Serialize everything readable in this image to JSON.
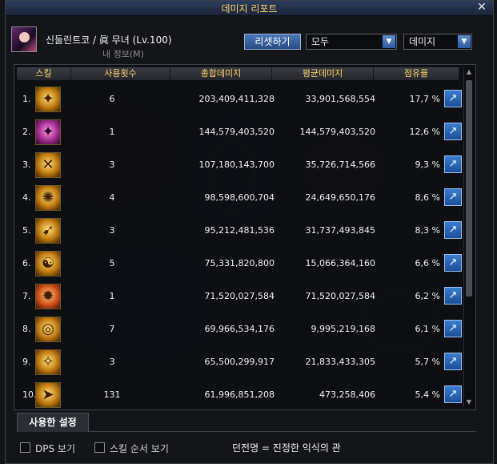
{
  "window": {
    "title": "데미지 리포트",
    "close_label": "✕"
  },
  "character": {
    "name": "신들린트코 / 眞 무녀 (Lv.100)",
    "subtitle": "내 정보(M)"
  },
  "controls": {
    "reset_label": "리셋하기",
    "filter_select": "모두",
    "metric_select": "데미지"
  },
  "table": {
    "headers": [
      "스킬",
      "사용횟수",
      "총합데미지",
      "평균데미지",
      "점유율"
    ],
    "rows": [
      {
        "index": "1.",
        "count": "6",
        "total": "203,409,411,328",
        "avg": "33,901,568,554",
        "share": "17,7 %"
      },
      {
        "index": "2.",
        "count": "1",
        "total": "144,579,403,520",
        "avg": "144,579,403,520",
        "share": "12,6 %"
      },
      {
        "index": "3.",
        "count": "3",
        "total": "107,180,143,700",
        "avg": "35,726,714,566",
        "share": "9,3 %"
      },
      {
        "index": "4.",
        "count": "4",
        "total": "98,598,600,704",
        "avg": "24,649,650,176",
        "share": "8,6 %"
      },
      {
        "index": "5.",
        "count": "3",
        "total": "95,212,481,536",
        "avg": "31,737,493,845",
        "share": "8,3 %"
      },
      {
        "index": "6.",
        "count": "5",
        "total": "75,331,820,800",
        "avg": "15,066,364,160",
        "share": "6,6 %"
      },
      {
        "index": "7.",
        "count": "1",
        "total": "71,520,027,584",
        "avg": "71,520,027,584",
        "share": "6,2 %"
      },
      {
        "index": "8.",
        "count": "7",
        "total": "69,966,534,176",
        "avg": "9,995,219,168",
        "share": "6,1 %"
      },
      {
        "index": "9.",
        "count": "3",
        "total": "65,500,299,917",
        "avg": "21,833,433,305",
        "share": "5,7 %"
      },
      {
        "index": "10.",
        "count": "131",
        "total": "61,996,851,208",
        "avg": "473,258,406",
        "share": "5,4 %"
      }
    ]
  },
  "tabs": {
    "used_settings": "사용한 설정"
  },
  "footer": {
    "dps_label": "DPS 보기",
    "order_label": "스킬 순서 보기",
    "dungeon_label": "던전명 = 진정한 익식의 관"
  },
  "icons": {
    "skill_icon": "skill-icon",
    "detail_icon": "share-detail-icon"
  },
  "colors": {
    "header_text": "#ffd46a",
    "accent_blue": "#3a7cd0"
  }
}
